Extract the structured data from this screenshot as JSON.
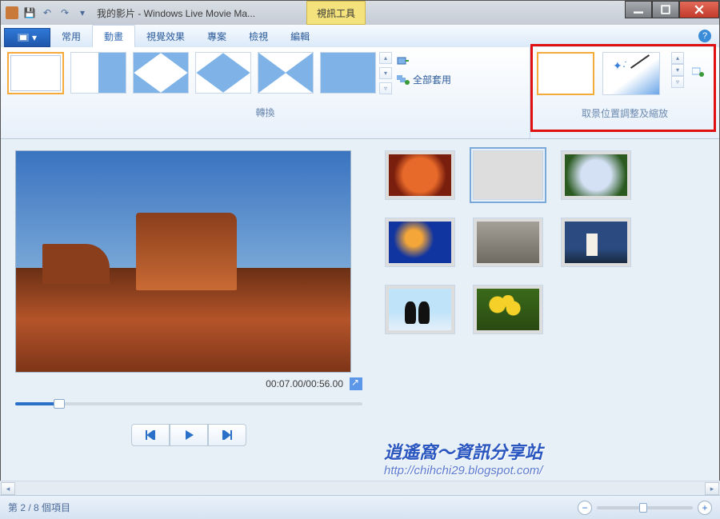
{
  "window": {
    "title": "我的影片 - Windows Live Movie Ma...",
    "context_tab": "視訊工具"
  },
  "ribbon": {
    "file_menu": "▾",
    "tabs": [
      "常用",
      "動畫",
      "視覺效果",
      "專案",
      "檢視",
      "編輯"
    ],
    "active_tab_index": 1,
    "transitions_label": "轉換",
    "apply_all": "全部套用",
    "panzoom_label": "取景位置調整及縮放"
  },
  "preview": {
    "time": "00:07.00/00:56.00"
  },
  "clips": [
    {
      "id": "flower"
    },
    {
      "id": "desert",
      "selected": true
    },
    {
      "id": "hydrangea"
    },
    {
      "id": "jellyfish"
    },
    {
      "id": "koala"
    },
    {
      "id": "lighthouse"
    },
    {
      "id": "penguins"
    },
    {
      "id": "tulips"
    }
  ],
  "status": {
    "items_text": "第 2 / 8 個項目"
  },
  "watermark": {
    "line1": "逍遙窩～資訊分享站",
    "line2": "http://chihchi29.blogspot.com/"
  }
}
